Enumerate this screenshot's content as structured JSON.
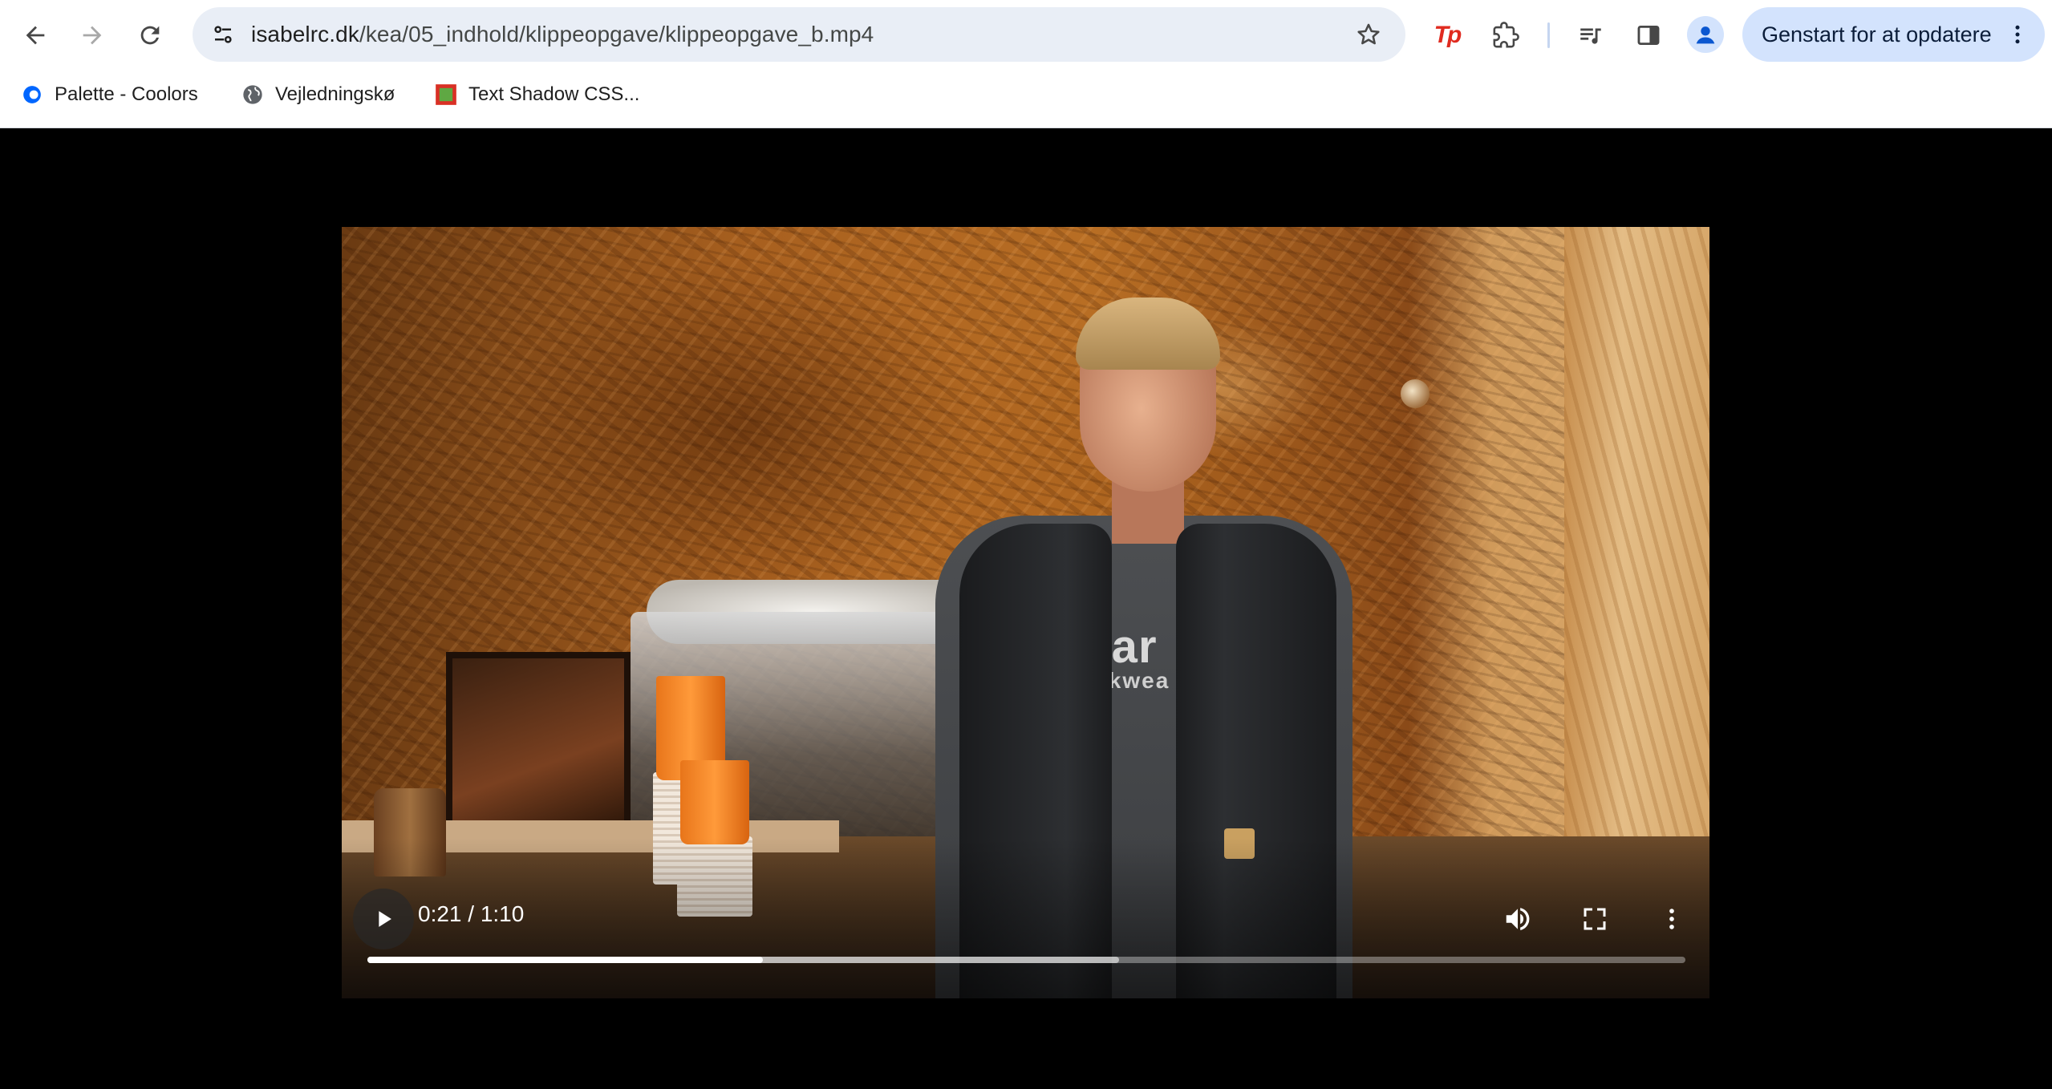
{
  "browser": {
    "url_host": "isabelrc.dk",
    "url_path": "/kea/05_indhold/klippeopgave/klippeopgave_b.mp4",
    "update_button_label": "Genstart for at opdatere",
    "extension_tp_label": "Tp",
    "icons": [
      "back-arrow-icon",
      "forward-arrow-icon",
      "reload-icon",
      "site-info-icon",
      "bookmark-star-icon",
      "puzzle-icon",
      "media-controls-icon",
      "side-panel-icon",
      "profile-icon",
      "kebab-menu-icon"
    ]
  },
  "bookmarks": [
    {
      "label": "Palette - Coolors"
    },
    {
      "label": "Vejledningskø"
    },
    {
      "label": "Text Shadow CSS..."
    }
  ],
  "video": {
    "time_display": "0:21 / 1:10",
    "shirt_text_line1": "char",
    "shirt_text_line2": "workwea",
    "progress_played_fraction": 0.3,
    "progress_buffered_fraction": 0.57
  }
}
